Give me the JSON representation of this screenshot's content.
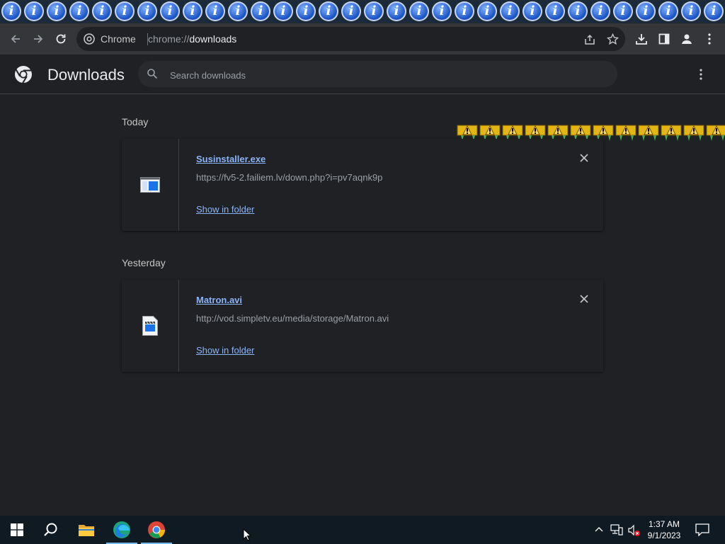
{
  "browser": {
    "omnibox_label": "Chrome",
    "url_scheme": "chrome://",
    "url_host": "downloads"
  },
  "downloads_page": {
    "title": "Downloads",
    "search_placeholder": "Search downloads"
  },
  "groups": [
    {
      "date_label": "Today",
      "item": {
        "file_name": "Susinstaller.exe",
        "url": "https://fv5-2.failiem.lv/down.php?i=pv7aqnk9p",
        "action": "Show in folder",
        "icon": "installer-file-icon"
      }
    },
    {
      "date_label": "Yesterday",
      "item": {
        "file_name": "Matron.avi",
        "url": "http://vod.simpletv.eu/media/storage/Matron.avi",
        "action": "Show in folder",
        "icon": "video-file-icon"
      }
    }
  ],
  "taskbar": {
    "time": "1:37 AM",
    "date": "9/1/2023"
  },
  "colors": {
    "link": "#8ab4f8",
    "background": "#202124",
    "toolbar": "#35363a",
    "taskbar": "#101a22"
  }
}
